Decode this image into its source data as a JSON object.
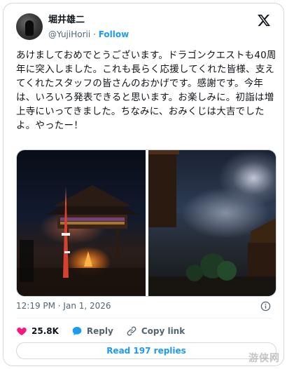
{
  "author": {
    "name": "堀井雄二",
    "handle": "@YujiHorii",
    "separator": "·",
    "follow_label": "Follow"
  },
  "tweet": {
    "text": "あけましておめでとうございます。ドラゴンクエストも40周年に突入しました。これも長らく応援してくれた皆様、支えてくれたスタッフの皆さんのおかげです。感謝です。今年は、いろいろ発表できると思います。お楽しみに。初詣は増上寺にいってきました。ちなみに、おみくじは大吉でしたよ。やったー！",
    "timestamp": "12:19 PM · Jan 1, 2026"
  },
  "media": {
    "images": [
      "temple-bonfire-photo",
      "tokyo-tower-photo"
    ]
  },
  "actions": {
    "like_count": "25.8K",
    "reply_label": "Reply",
    "copy_link_label": "Copy link",
    "read_replies_label": "Read 197 replies"
  },
  "watermark": "游侠网",
  "colors": {
    "like": "#f91880",
    "accent": "#1d9bf0",
    "muted": "#536471"
  },
  "icons": [
    "x-logo-icon",
    "info-icon",
    "heart-icon",
    "reply-icon",
    "link-icon"
  ]
}
